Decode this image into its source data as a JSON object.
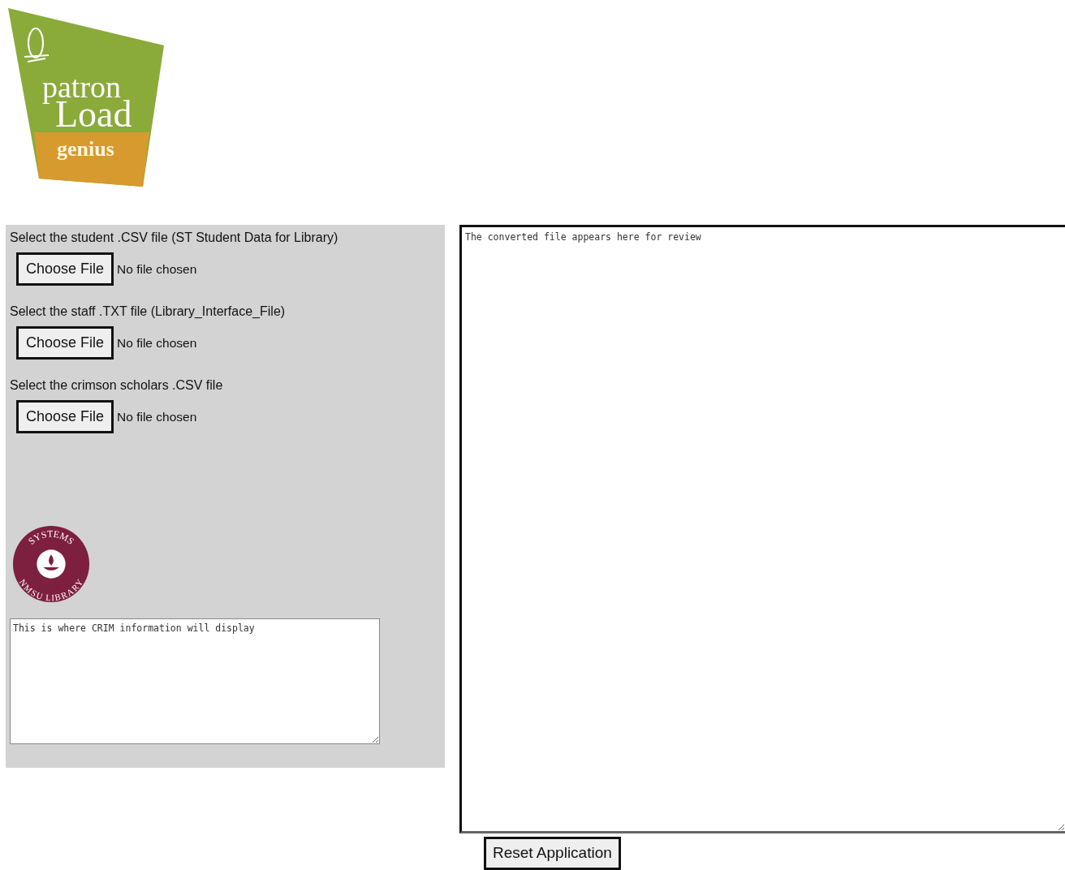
{
  "logo": {
    "line_1": "patron",
    "line_2": "Load",
    "line_3": "genius"
  },
  "uploads": [
    {
      "label": "Select the student .CSV file (ST Student Data for Library)",
      "button": "Choose File",
      "status": "No file chosen"
    },
    {
      "label": "Select the staff .TXT file (Library_Interface_File)",
      "button": "Choose File",
      "status": "No file chosen"
    },
    {
      "label": "Select the crimson scholars .CSV file",
      "button": "Choose File",
      "status": "No file chosen"
    }
  ],
  "seal": {
    "top_text": "SYSTEMS",
    "bottom_text": "NMSU LIBRARY"
  },
  "crim_box": {
    "placeholder": "This is where CRIM information will display"
  },
  "output_box": {
    "placeholder": "The converted file appears here for review"
  },
  "reset_button": "Reset Application"
}
